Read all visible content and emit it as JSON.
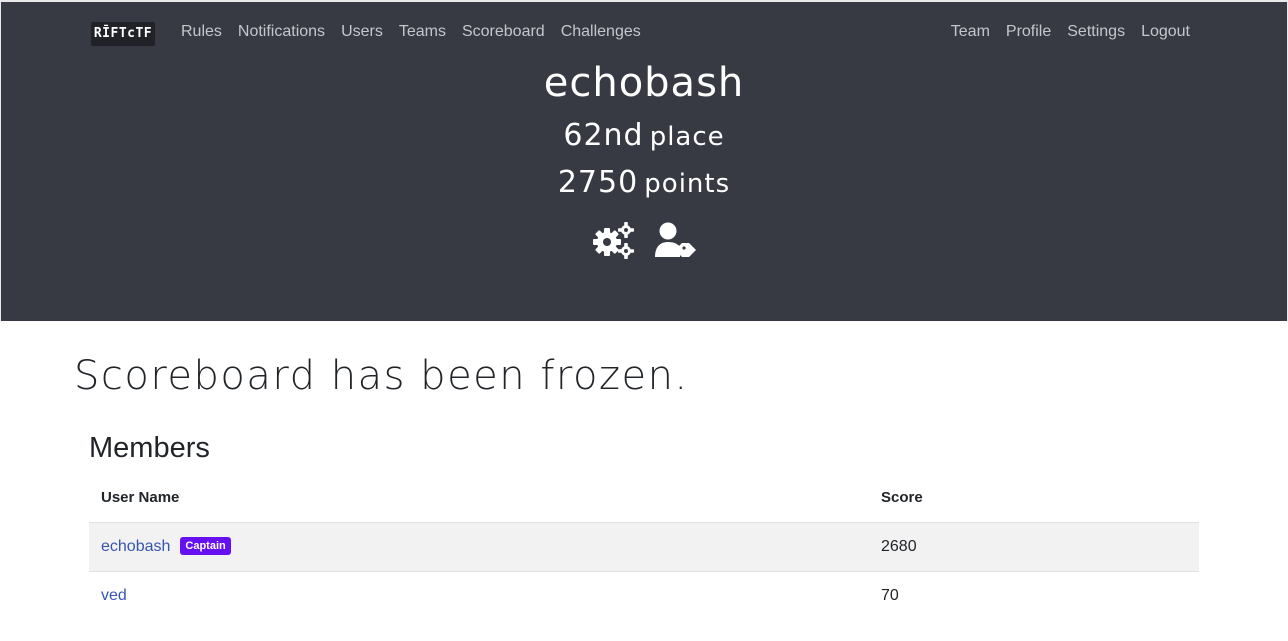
{
  "nav": {
    "brand": "RĪFTcTF",
    "left": [
      "Rules",
      "Notifications",
      "Users",
      "Teams",
      "Scoreboard",
      "Challenges"
    ],
    "right": [
      "Team",
      "Profile",
      "Settings",
      "Logout"
    ]
  },
  "team": {
    "name": "echobash",
    "place_num": "62nd",
    "place_word": "place",
    "points_num": "2750",
    "points_word": "points",
    "icons": [
      "settings-gears-icon",
      "user-tag-icon"
    ]
  },
  "notice": "Scoreboard has been frozen.",
  "members": {
    "title": "Members",
    "columns": [
      "User Name",
      "Score"
    ],
    "rows": [
      {
        "name": "echobash",
        "badge": "Captain",
        "score": "2680"
      },
      {
        "name": "ved",
        "badge": "",
        "score": "70"
      }
    ]
  },
  "colors": {
    "header_bg": "#373a43",
    "link": "#3755b3",
    "badge": "#6610f2"
  }
}
